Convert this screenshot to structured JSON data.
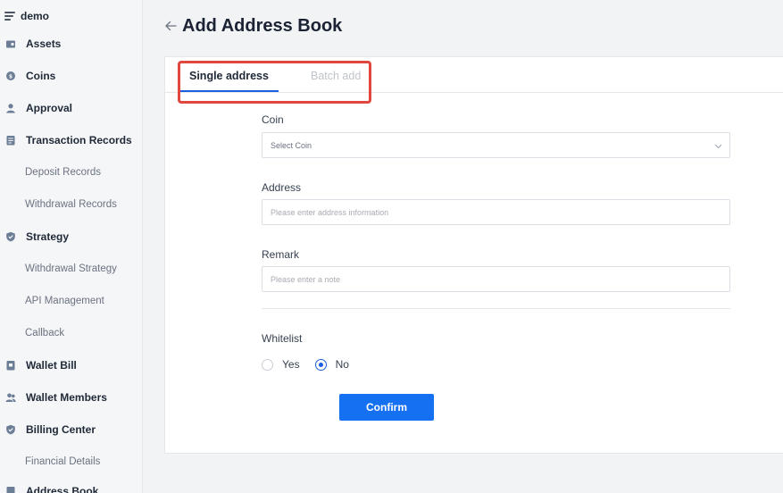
{
  "sidebar": {
    "brand": "demo",
    "items": [
      {
        "label": "Assets",
        "type": "top",
        "icon": "wallet-icon"
      },
      {
        "label": "Coins",
        "type": "top",
        "icon": "coin-icon"
      },
      {
        "label": "Approval",
        "type": "top",
        "icon": "user-icon"
      },
      {
        "label": "Transaction Records",
        "type": "top",
        "icon": "document-icon"
      },
      {
        "label": "Deposit Records",
        "type": "sub"
      },
      {
        "label": "Withdrawal Records",
        "type": "sub"
      },
      {
        "label": "Strategy",
        "type": "top",
        "icon": "shield-icon"
      },
      {
        "label": "Withdrawal Strategy",
        "type": "sub"
      },
      {
        "label": "API Management",
        "type": "sub"
      },
      {
        "label": "Callback",
        "type": "sub"
      },
      {
        "label": "Wallet Bill",
        "type": "top",
        "icon": "bill-icon"
      },
      {
        "label": "Wallet Members",
        "type": "top",
        "icon": "users-icon"
      },
      {
        "label": "Billing Center",
        "type": "top",
        "icon": "shield-icon"
      },
      {
        "label": "Financial Details",
        "type": "sub"
      },
      {
        "label": "Address Book",
        "type": "top",
        "icon": "book-icon"
      }
    ]
  },
  "header": {
    "title": "Add Address Book"
  },
  "tabs": {
    "single": "Single address",
    "batch": "Batch add",
    "active": "single"
  },
  "form": {
    "coin": {
      "label": "Coin",
      "placeholder": "Select Coin"
    },
    "address": {
      "label": "Address",
      "placeholder": "Please enter address information"
    },
    "remark": {
      "label": "Remark",
      "placeholder": "Please enter a note"
    },
    "whitelist": {
      "label": "Whitelist",
      "options": [
        "Yes",
        "No"
      ],
      "selected": "No"
    },
    "confirm_label": "Confirm"
  },
  "colors": {
    "accent": "#1670f2",
    "highlight": "#e0473f"
  }
}
